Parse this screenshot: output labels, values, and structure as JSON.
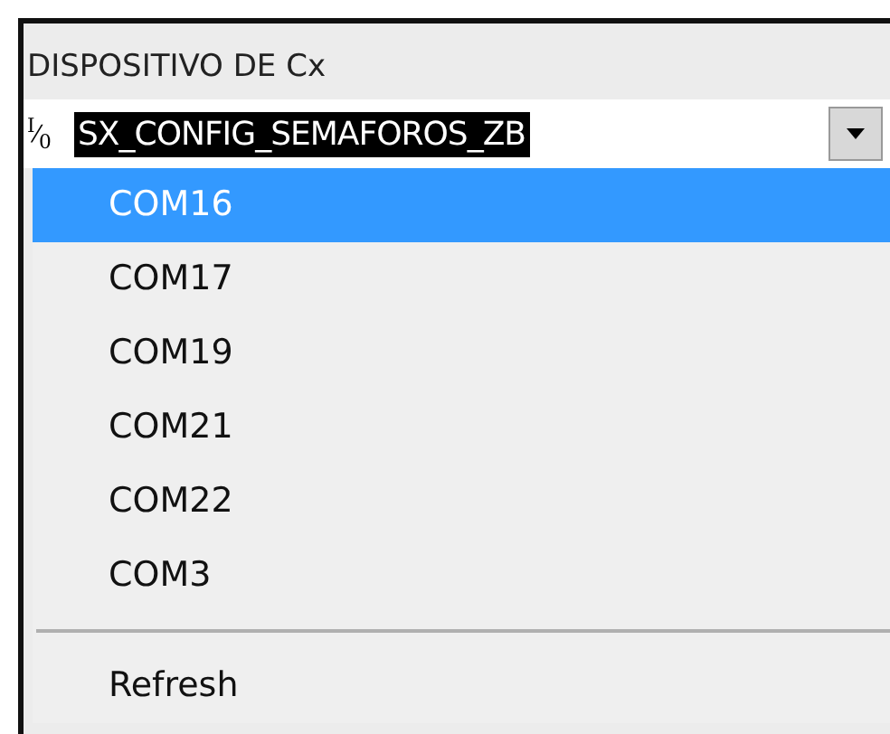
{
  "label": "DISPOSITIVO DE Cx",
  "combo": {
    "io_glyph": "$^{I}$⁄$_{0}$",
    "value": "SX_CONFIG_SEMAFOROS_ZB"
  },
  "menu": {
    "items": [
      {
        "label": "COM16",
        "selected": true
      },
      {
        "label": "COM17",
        "selected": false
      },
      {
        "label": "COM19",
        "selected": false
      },
      {
        "label": "COM21",
        "selected": false
      },
      {
        "label": "COM22",
        "selected": false
      },
      {
        "label": "COM3",
        "selected": false
      }
    ],
    "actions": [
      "Refresh"
    ]
  }
}
